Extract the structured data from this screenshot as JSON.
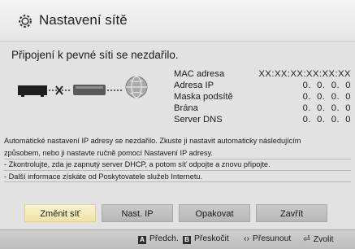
{
  "header": {
    "title": "Nastavení sítě"
  },
  "status": {
    "message": "Připojení k pevné síti se nezdařilo."
  },
  "network_info": [
    {
      "label": "MAC adresa",
      "value": "XX:XX:XX:XX:XX:XX"
    },
    {
      "label": "Adresa IP",
      "value": "0.  0.  0.  0"
    },
    {
      "label": "Maska podsítě",
      "value": "0.  0.  0.  0"
    },
    {
      "label": "Brána",
      "value": "0.  0.  0.  0"
    },
    {
      "label": "Server DNS",
      "value": "0.  0.  0.  0"
    }
  ],
  "description": {
    "line1": "Automatické nastavení IP adresy se nezdařilo. Zkuste ji nastavit automaticky následujícím",
    "line2": "způsobem, nebo ji nastavte ručně pomocí Nastavení IP adresy.",
    "line3": "- Zkontrolujte, zda je zapnutý server DHCP, a potom síť odpojte a znovu připojte.",
    "line4": "- Další informace získáte od Poskytovatele služeb Internetu."
  },
  "buttons": {
    "change_network": "Změnit síť",
    "ip_settings": "Nast. IP",
    "retry": "Opakovat",
    "close": "Zavřít",
    "selected": "change_network"
  },
  "footer": {
    "a_key": "A",
    "a_label": "Předch.",
    "b_key": "B",
    "b_label": "Přeskočit",
    "move_glyph": "‹›",
    "move_label": "Přesunout",
    "back_glyph": "⏎",
    "back_label": "Zvolit"
  },
  "colors": {
    "selected_button": "#f4ebbd",
    "button": "#c3c3c3",
    "background": "#e2e2e2"
  }
}
